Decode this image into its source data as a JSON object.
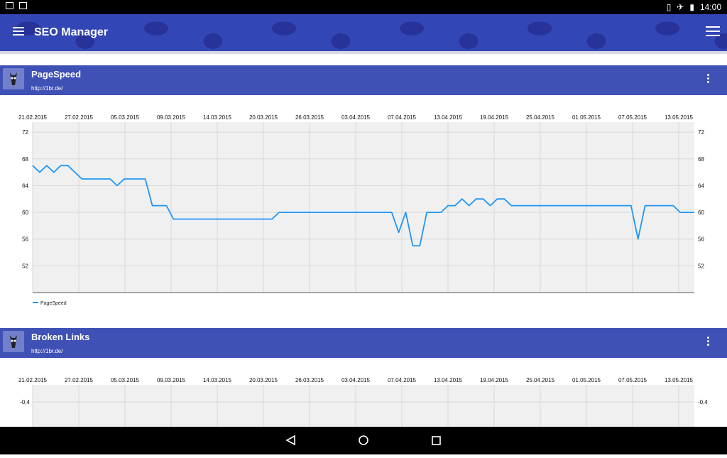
{
  "status": {
    "time": "14:00"
  },
  "appbar": {
    "title": "SEO Manager"
  },
  "cards": [
    {
      "title": "PageSpeed",
      "url": "http://1br.de/"
    },
    {
      "title": "Broken Links",
      "url": "http://1br.de/"
    }
  ],
  "dates": [
    "21.02.2015",
    "27.02.2015",
    "05.03.2015",
    "09.03.2015",
    "14.03.2015",
    "20.03.2015",
    "26.03.2015",
    "03.04.2015",
    "07.04.2015",
    "13.04.2015",
    "19.04.2015",
    "25.04.2015",
    "01.05.2015",
    "07.05.2015",
    "13.05.2015"
  ],
  "chart_data": [
    {
      "type": "line",
      "x": [
        "21.02.2015",
        "27.02.2015",
        "05.03.2015",
        "09.03.2015",
        "14.03.2015",
        "20.03.2015",
        "26.03.2015",
        "03.04.2015",
        "07.04.2015",
        "13.04.2015",
        "19.04.2015",
        "25.04.2015",
        "01.05.2015",
        "07.05.2015",
        "13.05.2015"
      ],
      "y_ticks": [
        72,
        68,
        64,
        60,
        56,
        52
      ],
      "ylim": [
        48,
        73.5
      ],
      "series": [
        {
          "name": "PageSpeed",
          "color": "#2196f3",
          "values": [
            67,
            66,
            67,
            66,
            67,
            67,
            66,
            65,
            65,
            65,
            65,
            65,
            64,
            65,
            65,
            65,
            65,
            61,
            61,
            61,
            59,
            59,
            59,
            59,
            59,
            59,
            59,
            59,
            59,
            59,
            59,
            59,
            59,
            59,
            59,
            60,
            60,
            60,
            60,
            60,
            60,
            60,
            60,
            60,
            60,
            60,
            60,
            60,
            60,
            60,
            60,
            60,
            57,
            60,
            55,
            55,
            60,
            60,
            60,
            61,
            61,
            62,
            61,
            62,
            62,
            61,
            62,
            62,
            61,
            61,
            61,
            61,
            61,
            61,
            61,
            61,
            61,
            61,
            61,
            61,
            61,
            61,
            61,
            61,
            61,
            61,
            56,
            61,
            61,
            61,
            61,
            61,
            60,
            60,
            60
          ]
        }
      ],
      "legend": "bottom-left",
      "grid": true
    },
    {
      "type": "line",
      "x": [
        "21.02.2015",
        "27.02.2015",
        "05.03.2015",
        "09.03.2015",
        "14.03.2015",
        "20.03.2015",
        "26.03.2015",
        "03.04.2015",
        "07.04.2015",
        "13.04.2015",
        "19.04.2015",
        "25.04.2015",
        "01.05.2015",
        "07.05.2015",
        "13.05.2015"
      ],
      "y_ticks": [
        "-0,4"
      ],
      "grid": true
    }
  ]
}
